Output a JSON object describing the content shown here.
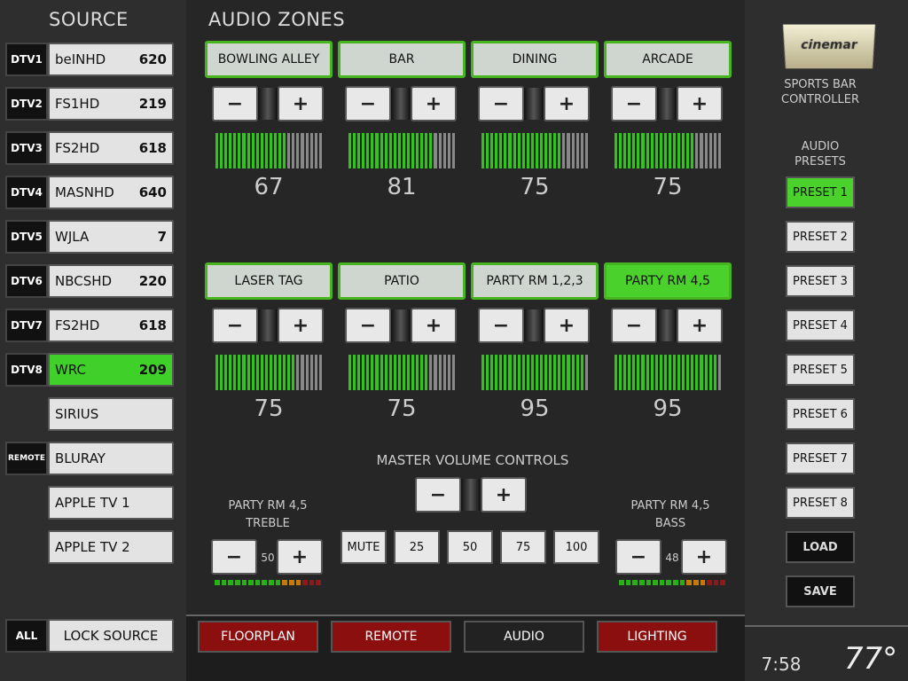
{
  "left": {
    "title": "SOURCE",
    "sources": [
      {
        "tag": "DTV1",
        "name": "beINHD",
        "num": "620"
      },
      {
        "tag": "DTV2",
        "name": "FS1HD",
        "num": "219"
      },
      {
        "tag": "DTV3",
        "name": "FS2HD",
        "num": "618"
      },
      {
        "tag": "DTV4",
        "name": "MASNHD",
        "num": "640"
      },
      {
        "tag": "DTV5",
        "name": "WJLA",
        "num": "7"
      },
      {
        "tag": "DTV6",
        "name": "NBCSHD",
        "num": "220"
      },
      {
        "tag": "DTV7",
        "name": "FS2HD",
        "num": "618"
      },
      {
        "tag": "DTV8",
        "name": "WRC",
        "num": "209"
      },
      {
        "tag": "",
        "name": "SIRIUS",
        "num": ""
      },
      {
        "tag": "REMOTE",
        "name": "BLURAY",
        "num": ""
      },
      {
        "tag": "",
        "name": "APPLE TV 1",
        "num": ""
      },
      {
        "tag": "",
        "name": "APPLE TV 2",
        "num": ""
      }
    ],
    "all_label": "ALL",
    "lock_label": "LOCK SOURCE"
  },
  "center": {
    "title": "AUDIO ZONES",
    "zones": [
      {
        "name": "BOWLING ALLEY",
        "level": 67
      },
      {
        "name": "BAR",
        "level": 81
      },
      {
        "name": "DINING",
        "level": 75
      },
      {
        "name": "ARCADE",
        "level": 75
      },
      {
        "name": "LASER TAG",
        "level": 75
      },
      {
        "name": "PATIO",
        "level": 75
      },
      {
        "name": "PARTY RM 1,2,3",
        "level": 95
      },
      {
        "name": "PARTY RM 4,5",
        "level": 95
      }
    ],
    "master_title": "MASTER VOLUME CONTROLS",
    "treble_zone": "PARTY RM 4,5",
    "treble_label": "TREBLE",
    "treble_value": "50",
    "bass_zone": "PARTY RM 4,5",
    "bass_label": "BASS",
    "bass_value": "48",
    "level_buttons": [
      "MUTE",
      "25",
      "50",
      "75",
      "100"
    ]
  },
  "tabs": [
    "FLOORPLAN",
    "REMOTE",
    "AUDIO",
    "LIGHTING"
  ],
  "right": {
    "logo": "cinemar",
    "subtitle_line1": "SPORTS BAR",
    "subtitle_line2": "CONTROLLER",
    "presets_title_line1": "AUDIO",
    "presets_title_line2": "PRESETS",
    "presets": [
      "PRESET 1",
      "PRESET 2",
      "PRESET 3",
      "PRESET 4",
      "PRESET 5",
      "PRESET 6",
      "PRESET 7",
      "PRESET 8"
    ],
    "load_label": "LOAD",
    "save_label": "SAVE",
    "time": "7:58 am",
    "temp": "77°"
  },
  "colors": {
    "accent_green": "#3fd02a",
    "tab_red": "#8b0f0f"
  },
  "icons": {
    "minus": "minus-icon",
    "plus": "plus-icon"
  }
}
